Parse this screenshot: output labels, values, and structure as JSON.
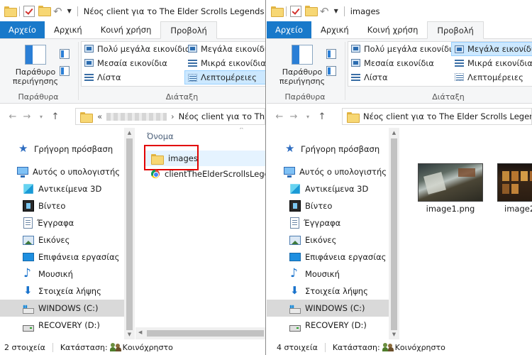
{
  "left": {
    "title": "Νέος client για το The Elder Scrolls Legends",
    "tabs": {
      "file": "Αρχείο",
      "home": "Αρχική",
      "share": "Κοινή χρήση",
      "view": "Προβολή"
    },
    "ribbon": {
      "nav_pane_label": "Παράθυρο περιήγησης",
      "panes_group": "Παράθυρα",
      "layout_group": "Διάταξη",
      "layout_items": [
        "Πολύ μεγάλα εικονίδια",
        "Μεγάλα εικονίδια",
        "Μεσαία εικονίδια",
        "Μικρά εικονίδια",
        "Λίστα",
        "Λεπτομέρειες"
      ],
      "selected_layout": "Λεπτομέρειες"
    },
    "address": {
      "prefix": "«",
      "current": "Νέος client για το Th"
    },
    "content": {
      "column_header": "Όνομα",
      "files": [
        "images",
        "clientTheElderScrollsLegends"
      ]
    },
    "status": {
      "count": "2 στοιχεία",
      "state_label": "Κατάσταση:",
      "state_value": "Κοινόχρηστο"
    }
  },
  "right": {
    "title": "images",
    "tabs": {
      "file": "Αρχείο",
      "home": "Αρχική",
      "share": "Κοινή χρήση",
      "view": "Προβολή"
    },
    "ribbon": {
      "nav_pane_label": "Παράθυρο περιήγησης",
      "panes_group": "Παράθυρα",
      "layout_group": "Διάταξη",
      "layout_items": [
        "Πολύ μεγάλα εικονίδια",
        "Μεγάλα εικονίδια",
        "Μεσαία εικονίδια",
        "Μικρά εικονίδια",
        "Λίστα",
        "Λεπτομέρειες"
      ],
      "selected_layout": "Μεγάλα εικονίδια"
    },
    "address": {
      "prefix": "«",
      "current": "Νέος client για το The Elder Scrolls Legends"
    },
    "content": {
      "files": [
        "image1.png",
        "image2"
      ]
    },
    "status": {
      "count": "4 στοιχεία",
      "state_label": "Κατάσταση:",
      "state_value": "Κοινόχρηστο"
    }
  },
  "nav_items": [
    "Γρήγορη πρόσβαση",
    "Αυτός ο υπολογιστής",
    "Αντικείμενα 3D",
    "Βίντεο",
    "Έγγραφα",
    "Εικόνες",
    "Επιφάνεια εργασίας",
    "Μουσική",
    "Στοιχεία λήψης",
    "WINDOWS (C:)",
    "RECOVERY (D:)"
  ],
  "icons": [
    "folder-icon",
    "check-icon",
    "undo-icon",
    "star-icon",
    "computer-icon",
    "3d-objects-icon",
    "video-icon",
    "documents-icon",
    "pictures-icon",
    "desktop-icon",
    "music-icon",
    "downloads-icon",
    "drive-icon",
    "chrome-icon",
    "share-users-icon"
  ],
  "colors": {
    "file_tab": "#1979ca",
    "selection": "#cce8ff",
    "highlight_frame": "#e20000"
  }
}
